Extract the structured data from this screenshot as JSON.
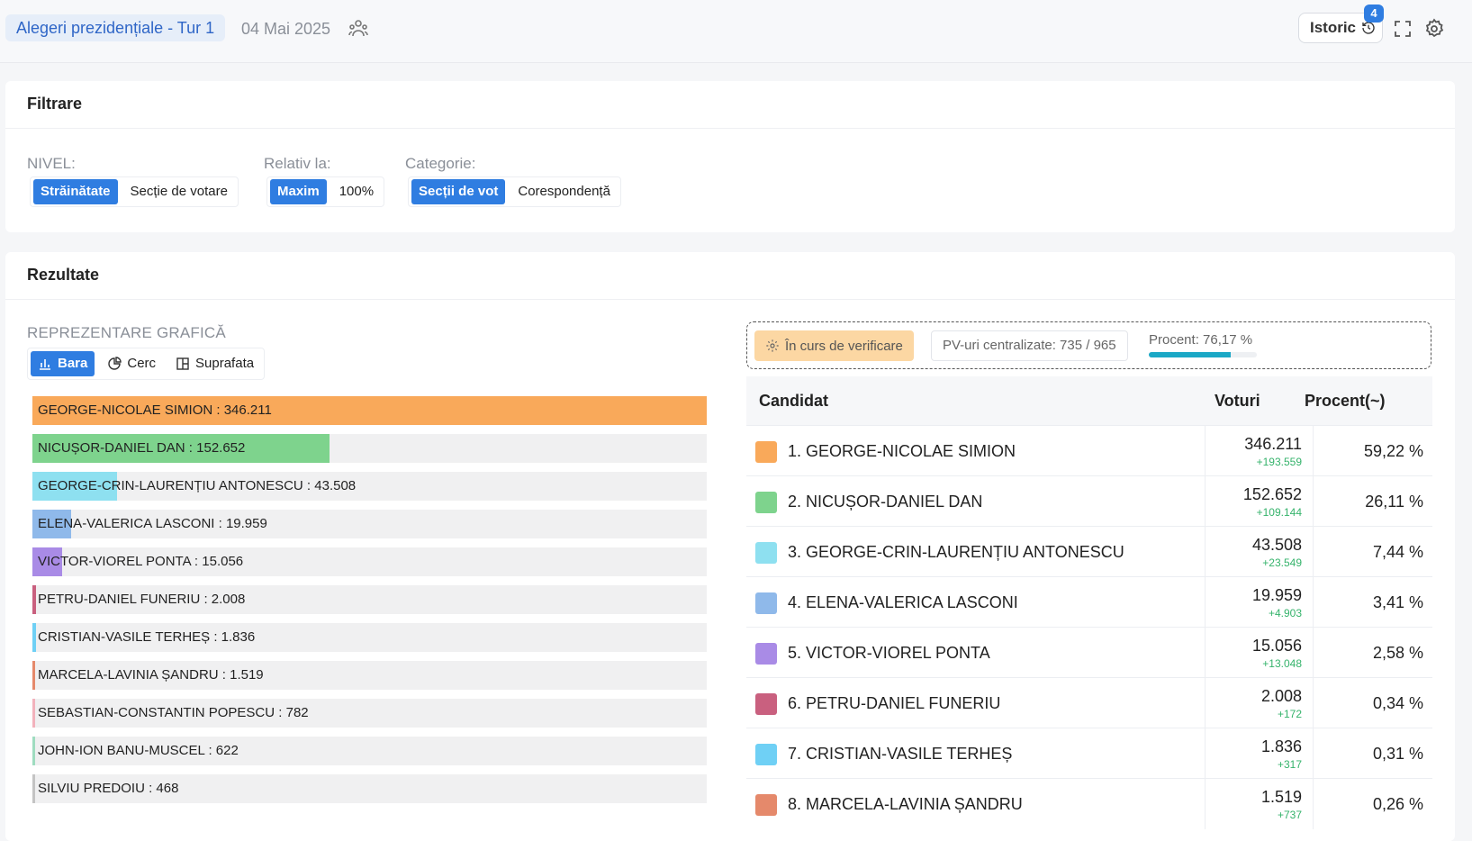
{
  "header": {
    "title": "Alegeri prezidențiale - Tur 1",
    "date": "04 Mai 2025",
    "istoric_label": "Istoric",
    "istoric_badge": "4",
    "icons": [
      "people-icon",
      "history-icon",
      "fullscreen-icon",
      "gear-icon"
    ]
  },
  "filters": {
    "title": "Filtrare",
    "groups": [
      {
        "label": "NIVEL:",
        "options": [
          "Străinătate",
          "Secție de votare"
        ],
        "active": 0
      },
      {
        "label": "Relativ la:",
        "options": [
          "Maxim",
          "100%"
        ],
        "active": 0
      },
      {
        "label": "Categorie:",
        "options": [
          "Secții de vot",
          "Corespondență"
        ],
        "active": 0
      }
    ]
  },
  "results": {
    "title": "Rezultate",
    "rep_label": "REPREZENTARE GRAFICĂ",
    "chart_types": [
      "Bara",
      "Cerc",
      "Suprafata"
    ],
    "active_chart_type": 0,
    "status": {
      "verification": "În curs de verificare",
      "pv": "PV-uri centralizate: 735 / 965",
      "procent_label": "Procent: 76,17 %",
      "procent_value": 76.17
    },
    "table": {
      "headers": {
        "candidate": "Candidat",
        "votes": "Voturi",
        "percent": "Procent(~)"
      },
      "rows": [
        {
          "name": "1. GEORGE-NICOLAE SIMION",
          "votes": "346.211",
          "delta": "+193.559",
          "percent": "59,22 %",
          "color": "#f9a95a"
        },
        {
          "name": "2. NICUȘOR-DANIEL DAN",
          "votes": "152.652",
          "delta": "+109.144",
          "percent": "26,11 %",
          "color": "#7ed38d"
        },
        {
          "name": "3. GEORGE-CRIN-LAURENȚIU ANTONESCU",
          "votes": "43.508",
          "delta": "+23.549",
          "percent": "7,44 %",
          "color": "#8ee0f0"
        },
        {
          "name": "4. ELENA-VALERICA LASCONI",
          "votes": "19.959",
          "delta": "+4.903",
          "percent": "3,41 %",
          "color": "#8fb9ea"
        },
        {
          "name": "5. VICTOR-VIOREL PONTA",
          "votes": "15.056",
          "delta": "+13.048",
          "percent": "2,58 %",
          "color": "#a98be6"
        },
        {
          "name": "6. PETRU-DANIEL FUNERIU",
          "votes": "2.008",
          "delta": "+172",
          "percent": "0,34 %",
          "color": "#c9607f"
        },
        {
          "name": "7. CRISTIAN-VASILE TERHEȘ",
          "votes": "1.836",
          "delta": "+317",
          "percent": "0,31 %",
          "color": "#6fd0f5"
        },
        {
          "name": "8. MARCELA-LAVINIA ȘANDRU",
          "votes": "1.519",
          "delta": "+737",
          "percent": "0,26 %",
          "color": "#e5896b"
        }
      ]
    }
  },
  "chart_data": {
    "type": "bar",
    "orientation": "horizontal",
    "categories": [
      "GEORGE-NICOLAE SIMION",
      "NICUȘOR-DANIEL DAN",
      "GEORGE-CRIN-LAURENȚIU ANTONESCU",
      "ELENA-VALERICA LASCONI",
      "VICTOR-VIOREL PONTA",
      "PETRU-DANIEL FUNERIU",
      "CRISTIAN-VASILE TERHEȘ",
      "MARCELA-LAVINIA ȘANDRU",
      "SEBASTIAN-CONSTANTIN POPESCU",
      "JOHN-ION BANU-MUSCEL",
      "SILVIU PREDOIU"
    ],
    "labels": [
      "GEORGE-NICOLAE SIMION : 346.211",
      "NICUȘOR-DANIEL DAN : 152.652",
      "GEORGE-CRIN-LAURENȚIU ANTONESCU : 43.508",
      "ELENA-VALERICA LASCONI : 19.959",
      "VICTOR-VIOREL PONTA : 15.056",
      "PETRU-DANIEL FUNERIU : 2.008",
      "CRISTIAN-VASILE TERHEȘ : 1.836",
      "MARCELA-LAVINIA ȘANDRU : 1.519",
      "SEBASTIAN-CONSTANTIN POPESCU : 782",
      "JOHN-ION BANU-MUSCEL : 622",
      "SILVIU PREDOIU : 468"
    ],
    "values": [
      346211,
      152652,
      43508,
      19959,
      15056,
      2008,
      1836,
      1519,
      782,
      622,
      468
    ],
    "colors": [
      "#f9a95a",
      "#7ed38d",
      "#8ee0f0",
      "#8fb9ea",
      "#a98be6",
      "#c9607f",
      "#6fd0f5",
      "#e5896b",
      "#f2b2bc",
      "#9fdcc0",
      "#c4c4c4"
    ],
    "xlim": [
      0,
      346211
    ]
  }
}
